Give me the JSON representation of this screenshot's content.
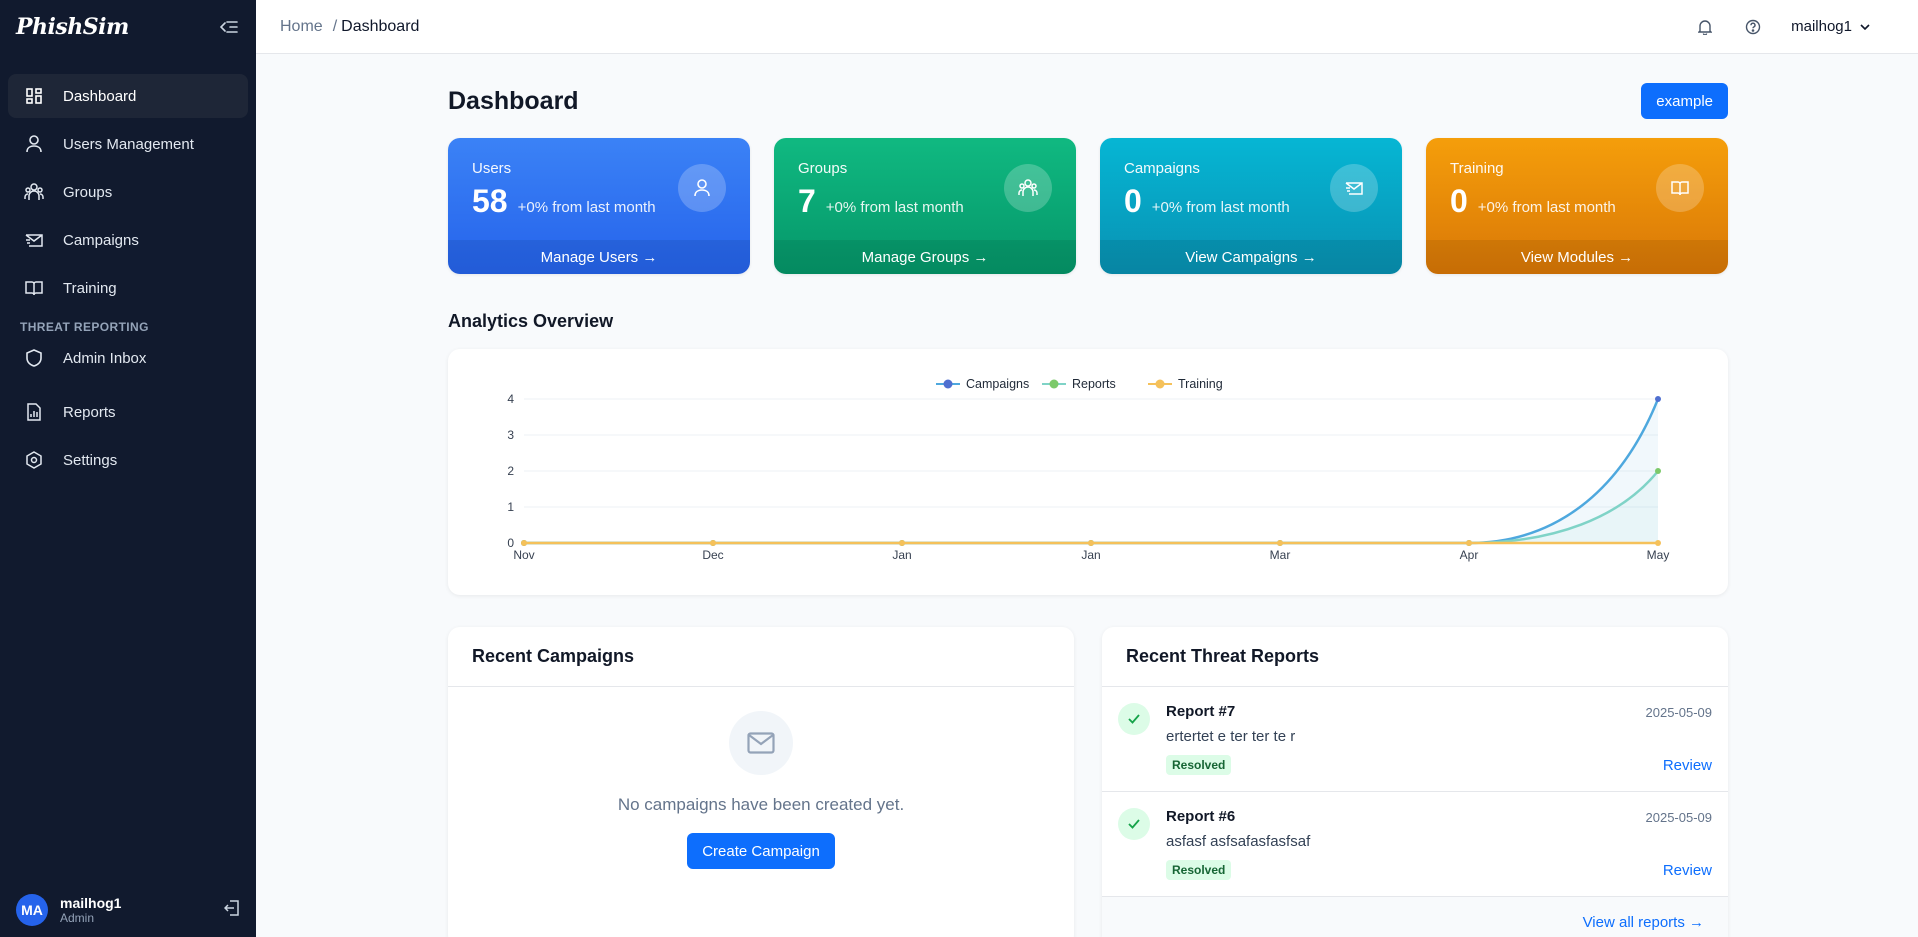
{
  "app": {
    "brand": "PhishSim"
  },
  "sidebar": {
    "items": [
      {
        "label": "Dashboard",
        "icon": "dashboard-icon",
        "active": true
      },
      {
        "label": "Users Management",
        "icon": "user-icon"
      },
      {
        "label": "Groups",
        "icon": "groups-icon"
      },
      {
        "label": "Campaigns",
        "icon": "mail-send-icon"
      },
      {
        "label": "Training",
        "icon": "book-icon"
      }
    ],
    "section_label": "THREAT REPORTING",
    "items2": [
      {
        "label": "Admin Inbox",
        "icon": "shield-icon"
      },
      {
        "label": "Reports",
        "icon": "report-chart-icon"
      },
      {
        "label": "Settings",
        "icon": "settings-icon"
      }
    ],
    "footer": {
      "initials": "MA",
      "name": "mailhog1",
      "role": "Admin"
    }
  },
  "topbar": {
    "breadcrumb": [
      "Home",
      "Dashboard"
    ],
    "separator": "/",
    "user": "mailhog1"
  },
  "page": {
    "title": "Dashboard",
    "action_label": "example"
  },
  "stats": [
    {
      "label": "Users",
      "value": "58",
      "delta": "+0% from last month",
      "link": "Manage Users →",
      "color": "#3b82f6"
    },
    {
      "label": "Groups",
      "value": "7",
      "delta": "+0% from last month",
      "link": "Manage Groups →",
      "color": "#10b981"
    },
    {
      "label": "Campaigns",
      "value": "0",
      "delta": "+0% from last month",
      "link": "View Campaigns →",
      "color": "#06b6d4"
    },
    {
      "label": "Training",
      "value": "0",
      "delta": "+0% from last month",
      "link": "View Modules →",
      "color": "#f59e0b"
    }
  ],
  "analytics": {
    "title": "Analytics Overview"
  },
  "chart_data": {
    "type": "line",
    "categories": [
      "Nov",
      "Dec",
      "Jan",
      "Jan",
      "Mar",
      "Apr",
      "May"
    ],
    "yticks": [
      0,
      1,
      2,
      3,
      4
    ],
    "ylim": [
      0,
      4
    ],
    "legend": "top-center",
    "series": [
      {
        "name": "Campaigns",
        "values": [
          0,
          0,
          0,
          0,
          0,
          0,
          4
        ],
        "color": "#4ea8de",
        "marker": "#4f6fd0"
      },
      {
        "name": "Reports",
        "values": [
          0,
          0,
          0,
          0,
          0,
          0,
          2
        ],
        "color": "#7fd3c7",
        "marker": "#7cc96a"
      },
      {
        "name": "Training",
        "values": [
          0,
          0,
          0,
          0,
          0,
          0,
          0
        ],
        "color": "#f5c15a",
        "marker": "#f5c15a"
      }
    ]
  },
  "recent_campaigns": {
    "title": "Recent Campaigns",
    "empty_text": "No campaigns have been created yet.",
    "create_label": "Create Campaign"
  },
  "recent_reports": {
    "title": "Recent Threat Reports",
    "items": [
      {
        "title": "Report #7",
        "desc": "ertertet e ter ter te r",
        "status": "Resolved",
        "date": "2025-05-09",
        "action": "Review"
      },
      {
        "title": "Report #6",
        "desc": "asfasf asfsafasfasfsaf",
        "status": "Resolved",
        "date": "2025-05-09",
        "action": "Review"
      }
    ],
    "view_all": "View all reports →"
  }
}
